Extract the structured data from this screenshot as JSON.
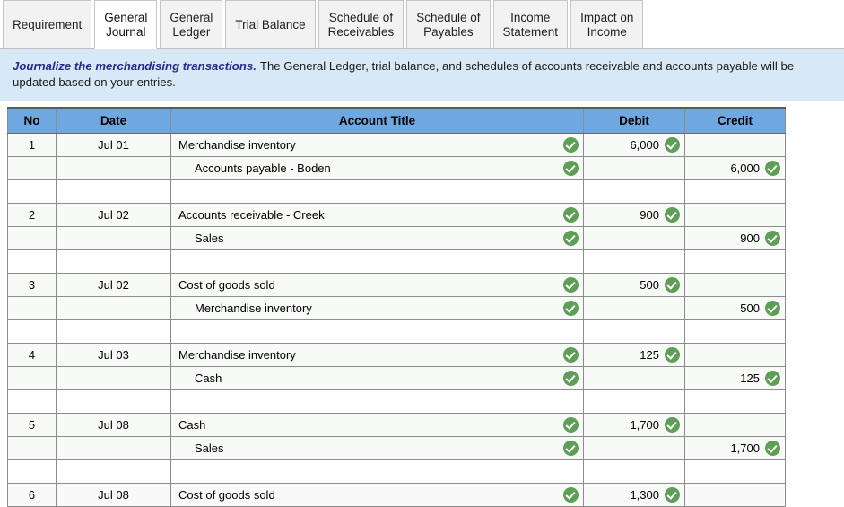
{
  "tabs": [
    {
      "label": "Requirement",
      "active": false
    },
    {
      "label": "General\nJournal",
      "active": true
    },
    {
      "label": "General\nLedger",
      "active": false
    },
    {
      "label": "Trial Balance",
      "active": false
    },
    {
      "label": "Schedule of\nReceivables",
      "active": false
    },
    {
      "label": "Schedule of\nPayables",
      "active": false
    },
    {
      "label": "Income\nStatement",
      "active": false
    },
    {
      "label": "Impact on\nIncome",
      "active": false
    }
  ],
  "banner": {
    "title": "Journalize the merchandising transactions.",
    "text": "The General Ledger, trial balance, and schedules of accounts receivable and accounts payable will be updated based on your entries."
  },
  "table": {
    "headers": [
      "No",
      "Date",
      "Account Title",
      "Debit",
      "Credit"
    ],
    "rows": [
      {
        "type": "entry",
        "no": "1",
        "date": "Jul 01",
        "account": "Merchandise inventory",
        "indent": false,
        "debit": "6,000",
        "credit": "",
        "account_check": true,
        "debit_check": true,
        "credit_check": false
      },
      {
        "type": "entry",
        "no": "",
        "date": "",
        "account": "Accounts payable - Boden",
        "indent": true,
        "debit": "",
        "credit": "6,000",
        "account_check": true,
        "debit_check": false,
        "credit_check": true
      },
      {
        "type": "blank",
        "no": "",
        "date": "",
        "account": "",
        "indent": false,
        "debit": "",
        "credit": "",
        "account_check": false,
        "debit_check": false,
        "credit_check": false
      },
      {
        "type": "entry",
        "no": "2",
        "date": "Jul 02",
        "account": "Accounts receivable - Creek",
        "indent": false,
        "debit": "900",
        "credit": "",
        "account_check": true,
        "debit_check": true,
        "credit_check": false
      },
      {
        "type": "entry",
        "no": "",
        "date": "",
        "account": "Sales",
        "indent": true,
        "debit": "",
        "credit": "900",
        "account_check": true,
        "debit_check": false,
        "credit_check": true
      },
      {
        "type": "blank",
        "no": "",
        "date": "",
        "account": "",
        "indent": false,
        "debit": "",
        "credit": "",
        "account_check": false,
        "debit_check": false,
        "credit_check": false
      },
      {
        "type": "entry",
        "no": "3",
        "date": "Jul 02",
        "account": "Cost of goods sold",
        "indent": false,
        "debit": "500",
        "credit": "",
        "account_check": true,
        "debit_check": true,
        "credit_check": false
      },
      {
        "type": "entry",
        "no": "",
        "date": "",
        "account": "Merchandise inventory",
        "indent": true,
        "debit": "",
        "credit": "500",
        "account_check": true,
        "debit_check": false,
        "credit_check": true
      },
      {
        "type": "blank",
        "no": "",
        "date": "",
        "account": "",
        "indent": false,
        "debit": "",
        "credit": "",
        "account_check": false,
        "debit_check": false,
        "credit_check": false
      },
      {
        "type": "entry",
        "no": "4",
        "date": "Jul 03",
        "account": "Merchandise inventory",
        "indent": false,
        "debit": "125",
        "credit": "",
        "account_check": true,
        "debit_check": true,
        "credit_check": false
      },
      {
        "type": "entry",
        "no": "",
        "date": "",
        "account": "Cash",
        "indent": true,
        "debit": "",
        "credit": "125",
        "account_check": true,
        "debit_check": false,
        "credit_check": true
      },
      {
        "type": "blank",
        "no": "",
        "date": "",
        "account": "",
        "indent": false,
        "debit": "",
        "credit": "",
        "account_check": false,
        "debit_check": false,
        "credit_check": false
      },
      {
        "type": "entry",
        "no": "5",
        "date": "Jul 08",
        "account": "Cash",
        "indent": false,
        "debit": "1,700",
        "credit": "",
        "account_check": true,
        "debit_check": true,
        "credit_check": false
      },
      {
        "type": "entry",
        "no": "",
        "date": "",
        "account": "Sales",
        "indent": true,
        "debit": "",
        "credit": "1,700",
        "account_check": true,
        "debit_check": false,
        "credit_check": true
      },
      {
        "type": "blank",
        "no": "",
        "date": "",
        "account": "",
        "indent": false,
        "debit": "",
        "credit": "",
        "account_check": false,
        "debit_check": false,
        "credit_check": false
      },
      {
        "type": "entry",
        "no": "6",
        "date": "Jul 08",
        "account": "Cost of goods sold",
        "indent": false,
        "debit": "1,300",
        "credit": "",
        "account_check": true,
        "debit_check": true,
        "credit_check": false
      }
    ]
  },
  "colors": {
    "header_blue": "#6fa8e0",
    "banner_blue": "#d7e9f7",
    "banner_title": "#2a2a8c",
    "check_green": "#5e9e57",
    "entry_row": "#f7faf7"
  }
}
